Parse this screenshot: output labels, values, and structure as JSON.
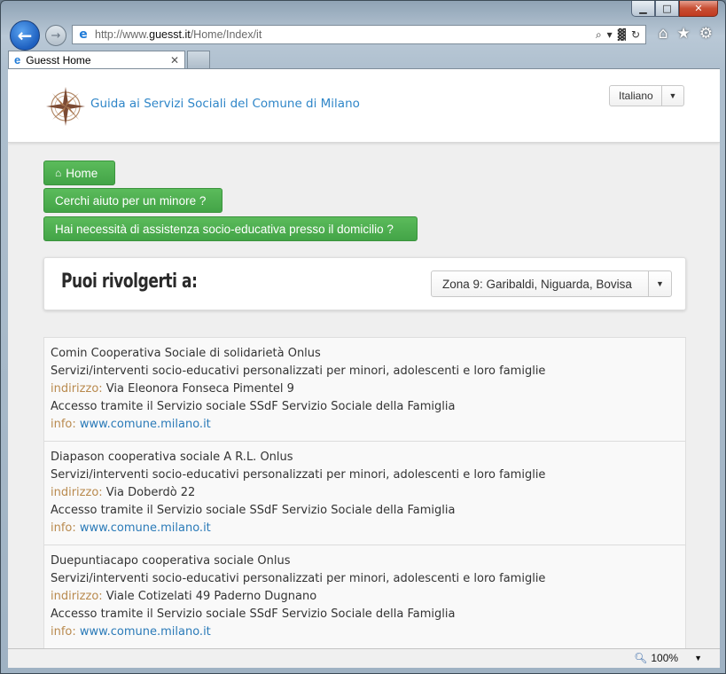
{
  "window": {
    "controls": {
      "minimize": "▁",
      "maximize": "□",
      "close": "✕"
    }
  },
  "browser": {
    "address_prefix": "http://www.",
    "address_domain": "guesst.it",
    "address_path": "/Home/Index/it",
    "tab_title": "Guesst Home",
    "tab_close": "✕",
    "icons": [
      "back-arrow-icon",
      "forward-arrow-icon",
      "ie-logo-icon",
      "search-icon",
      "compat-view-icon",
      "refresh-icon",
      "home-icon",
      "favorites-star-icon",
      "settings-gear-icon"
    ],
    "zoom": "100%"
  },
  "site": {
    "title": "Guida ai Servizi Sociali del Comune di Milano",
    "language": "Italiano"
  },
  "nav": {
    "home": "Home",
    "minor": "Cerchi aiuto per un minore ?",
    "domicile": "Hai necessità di assistenza socio-educativa presso il domicilio ?"
  },
  "panel": {
    "title": "Puoi rivolgerti a:",
    "zone": "Zona 9: Garibaldi, Niguarda, Bovisa"
  },
  "labels": {
    "address": "indirizzo:",
    "info": "info:"
  },
  "results": [
    {
      "name": "Comin Cooperativa Sociale di solidarietà Onlus",
      "service": "Servizi/interventi socio-educativi personalizzati per minori, adolescenti e loro famiglie",
      "address": "Via Eleonora Fonseca Pimentel 9",
      "access": "Accesso tramite il Servizio sociale SSdF Servizio Sociale della Famiglia",
      "info": "www.comune.milano.it"
    },
    {
      "name": "Diapason cooperativa sociale A R.L. Onlus",
      "service": "Servizi/interventi socio-educativi personalizzati per minori, adolescenti e loro famiglie",
      "address": "Via Doberdò 22",
      "access": "Accesso tramite il Servizio sociale SSdF Servizio Sociale della Famiglia",
      "info": "www.comune.milano.it"
    },
    {
      "name": "Duepuntiacapo cooperativa sociale Onlus",
      "service": "Servizi/interventi socio-educativi personalizzati per minori, adolescenti e loro famiglie",
      "address": "Viale Cotizelati 49 Paderno Dugnano",
      "access": "Accesso tramite il Servizio sociale SSdF Servizio Sociale della Famiglia",
      "info": "www.comune.milano.it"
    }
  ],
  "colors": {
    "link": "#2a7ab8",
    "label": "#b98a4e",
    "button_green": "#4cae4c",
    "site_title": "#2f86c8"
  }
}
